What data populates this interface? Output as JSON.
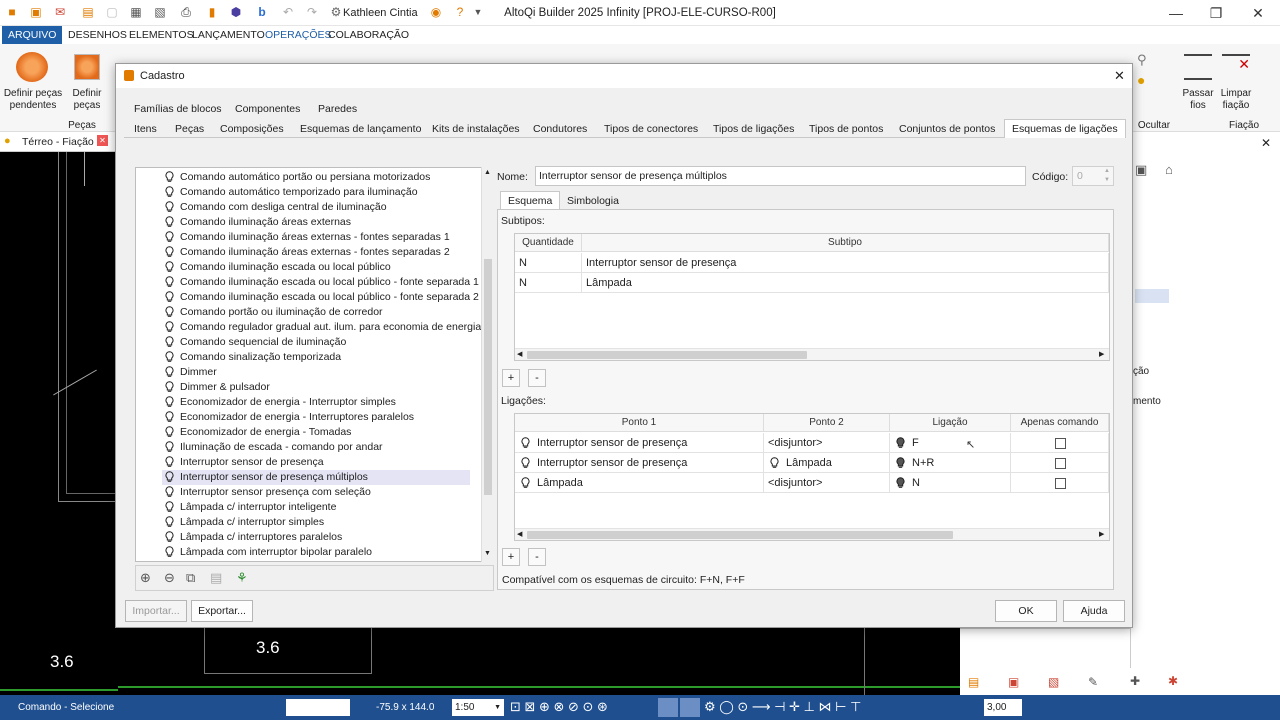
{
  "titlebar": {
    "user": "Kathleen Cintia",
    "title": "AltoQi Builder 2025 Infinity [PROJ-ELE-CURSO-R00]"
  },
  "menu": [
    "ARQUIVO",
    "DESENHOS",
    "ELEMENTOS",
    "LANÇAMENTO",
    "OPERAÇÕES",
    "COLABORAÇÃO"
  ],
  "ribbon": {
    "definir_pecas_pendentes": "Definir peças pendentes",
    "definir_pecas": "Definir peças",
    "group_pecas": "Peças",
    "passar_fios": "Passar fios",
    "limpar_fiacao": "Limpar fiação",
    "group_ocultar": "Ocultar",
    "group_fiacao": "Fiação"
  },
  "doc_tab": "Térreo - Fiação",
  "right_panel": {
    "text1": "ção",
    "text2": "mento"
  },
  "canvas": {
    "label1": "3.6",
    "label2": "3.6"
  },
  "dialog": {
    "title": "Cadastro",
    "tabs_row1": [
      "Famílias de blocos",
      "Componentes",
      "Paredes"
    ],
    "tabs_row2": [
      "Itens",
      "Peças",
      "Composições",
      "Esquemas de lançamento",
      "Kits de instalações",
      "Condutores",
      "Tipos de conectores",
      "Tipos de ligações",
      "Tipos de pontos",
      "Conjuntos de pontos",
      "Esquemas de ligações"
    ],
    "list": [
      "Comando automático portão ou persiana motorizados",
      "Comando automático temporizado para iluminação",
      "Comando com desliga central de iluminação",
      "Comando iluminação áreas externas",
      "Comando iluminação áreas externas - fontes separadas 1",
      "Comando iluminação áreas externas - fontes separadas 2",
      "Comando iluminação escada ou local público",
      "Comando iluminação escada ou local público - fonte separada 1",
      "Comando iluminação escada ou local público - fonte separada 2",
      "Comando portão ou iluminação de corredor",
      "Comando regulador gradual aut. ilum. para economia de energia",
      "Comando sequencial de iluminação",
      "Comando sinalização temporizada",
      "Dimmer",
      "Dimmer & pulsador",
      "Economizador de energia - Interruptor simples",
      "Economizador de energia - Interruptores paralelos",
      "Economizador de energia - Tomadas",
      "Iluminação de escada - comando por andar",
      "Interruptor sensor de presença",
      "Interruptor sensor de presença múltiplos",
      "Interruptor sensor presença com seleção",
      "Lâmpada c/ interruptor inteligente",
      "Lâmpada c/ interruptor simples",
      "Lâmpada c/ interruptores paralelos",
      "Lâmpada com interruptor bipolar paralelo"
    ],
    "selected_index": 20,
    "nome_label": "Nome:",
    "nome_value": "Interruptor sensor de presença múltiplos",
    "codigo_label": "Código:",
    "codigo_value": "0",
    "inner_tabs": [
      "Esquema",
      "Simbologia"
    ],
    "subtipos_label": "Subtipos:",
    "subtipos_headers": [
      "Quantidade",
      "Subtipo"
    ],
    "subtipos_rows": [
      [
        "N",
        "Interruptor sensor de presença"
      ],
      [
        "N",
        "Lâmpada"
      ]
    ],
    "ligacoes_label": "Ligações:",
    "ligacoes_headers": [
      "Ponto 1",
      "Ponto 2",
      "Ligação",
      "Apenas comando"
    ],
    "ligacoes_rows": [
      {
        "p1": "Interruptor sensor de presença",
        "p2": "<disjuntor>",
        "lig": "F",
        "apenas": false
      },
      {
        "p1": "Interruptor sensor de presença",
        "p2": "Lâmpada",
        "lig": "N+R",
        "apenas": false
      },
      {
        "p1": "Lâmpada",
        "p2": "<disjuntor>",
        "lig": "N",
        "apenas": false
      }
    ],
    "compat_text": "Compatível com os esquemas de circuito:   F+N, F+F",
    "plus": "+",
    "minus": "-",
    "importar": "Importar...",
    "exportar": "Exportar...",
    "ok": "OK",
    "ajuda": "Ajuda"
  },
  "status": {
    "command": "Comando - Selecione",
    "coords": "-75.9 x 144.0",
    "scale": "1:50",
    "value": "3,00"
  },
  "colors": {
    "accent": "#1f5fa8",
    "statusbar": "#1f4f8f",
    "selection": "#e4e4f4"
  }
}
